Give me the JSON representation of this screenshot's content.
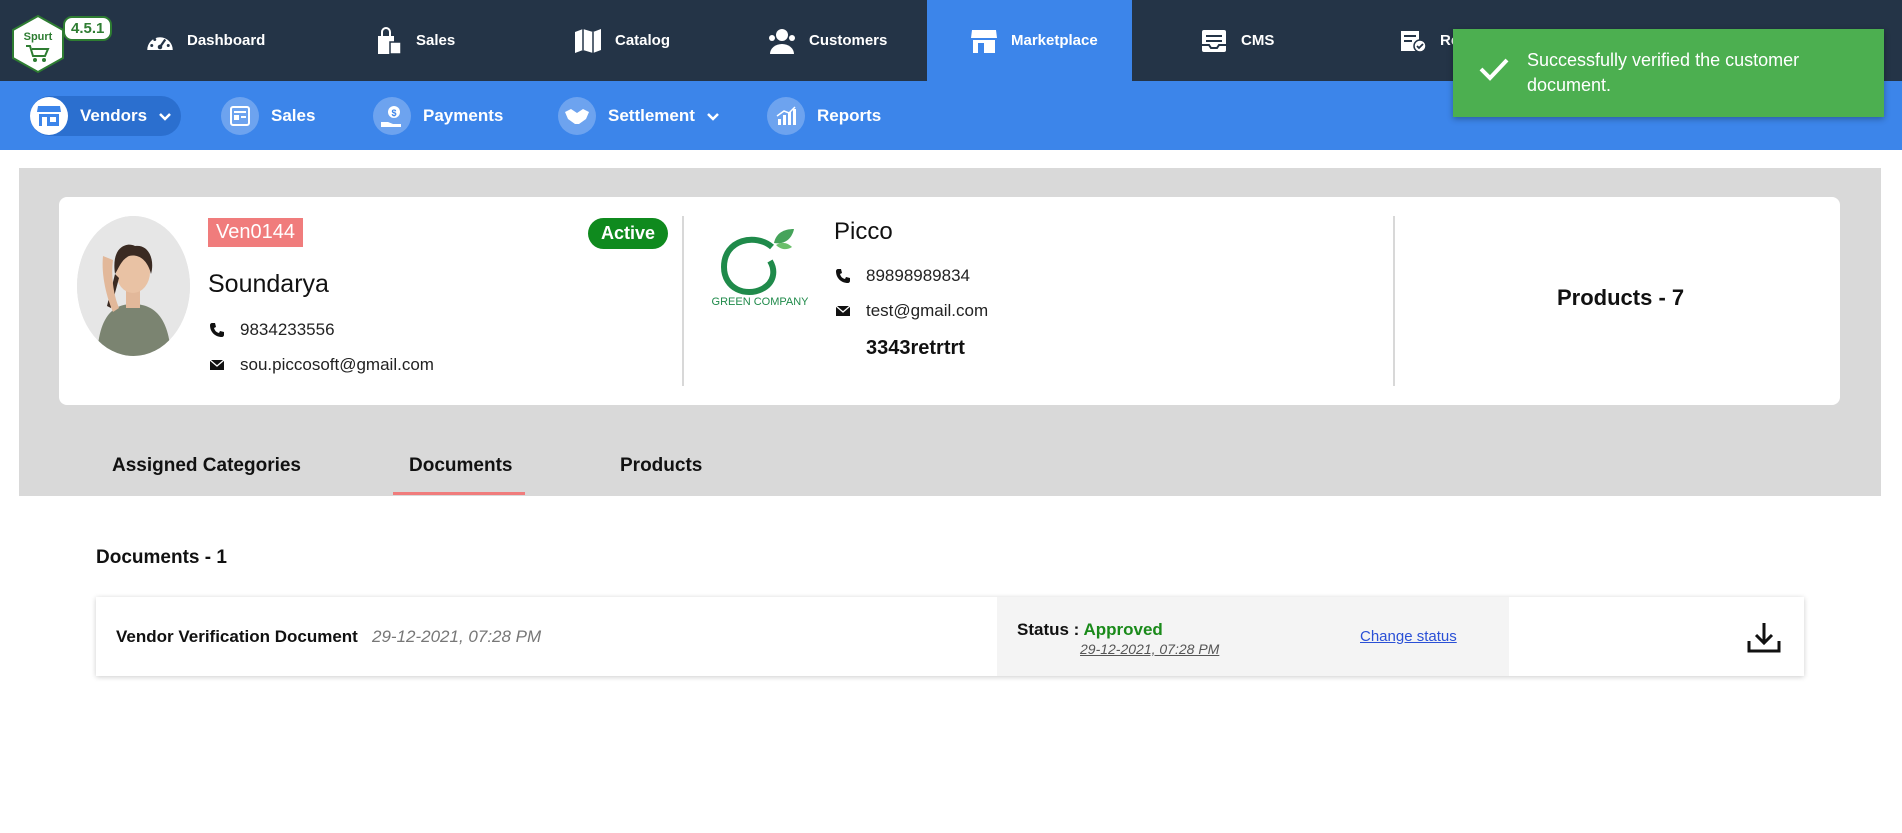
{
  "app": {
    "version": "4.5.1",
    "logo_text": "Spurt"
  },
  "topnav": [
    {
      "label": "Dashboard",
      "icon": "dashboard-icon"
    },
    {
      "label": "Sales",
      "icon": "shopping-bag-icon"
    },
    {
      "label": "Catalog",
      "icon": "map-icon"
    },
    {
      "label": "Customers",
      "icon": "users-icon"
    },
    {
      "label": "Marketplace",
      "icon": "store-icon",
      "active": true
    },
    {
      "label": "CMS",
      "icon": "inbox-icon"
    },
    {
      "label": "Re",
      "icon": "report-icon"
    }
  ],
  "subnav": [
    {
      "label": "Vendors",
      "icon": "vendor-store-icon",
      "selected": true,
      "dropdown": true
    },
    {
      "label": "Sales",
      "icon": "sales-form-icon"
    },
    {
      "label": "Payments",
      "icon": "payment-hand-icon"
    },
    {
      "label": "Settlement",
      "icon": "handshake-icon",
      "dropdown": true
    },
    {
      "label": "Reports",
      "icon": "bar-chart-icon"
    }
  ],
  "toast": {
    "message": "Successfully verified the customer document."
  },
  "vendor": {
    "id": "Ven0144",
    "status": "Active",
    "name": "Soundarya",
    "phone": "9834233556",
    "email": "sou.piccosoft@gmail.com"
  },
  "company": {
    "logo_text": "GREEN COMPANY",
    "name": "Picco",
    "phone": "89898989834",
    "email": "test@gmail.com",
    "code": "3343retrtrt"
  },
  "summary": {
    "products": "Products - 7"
  },
  "tabs": [
    {
      "label": "Assigned Categories"
    },
    {
      "label": "Documents",
      "active": true
    },
    {
      "label": "Products"
    }
  ],
  "documents": {
    "count_label": "Documents - 1",
    "items": [
      {
        "title": "Vendor Verification Document",
        "date": "29-12-2021, 07:28 PM",
        "status_label": "Status :",
        "status": "Approved",
        "status_date": "29-12-2021, 07:28 PM",
        "change_label": "Change status"
      }
    ]
  },
  "colors": {
    "topbar": "#243447",
    "accent": "#3c85ea",
    "toast": "#4caf50",
    "badge_active": "#0f8a1e",
    "vendor_id": "#f07c7c",
    "approved": "#1a8a1a"
  }
}
